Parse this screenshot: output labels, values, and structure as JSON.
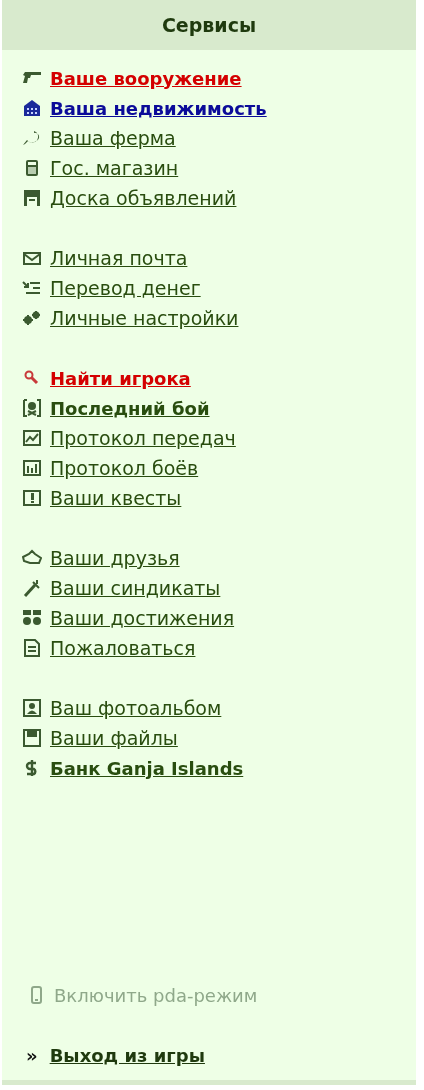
{
  "header": {
    "title": "Сервисы"
  },
  "groups": [
    {
      "items": [
        {
          "label": "Ваше вооружение",
          "kind": "alert"
        },
        {
          "label": "Ваша недвижимость",
          "kind": "new"
        },
        {
          "label": "Ваша ферма",
          "kind": "normal"
        },
        {
          "label": "Гос. магазин",
          "kind": "normal"
        },
        {
          "label": "Доска объявлений",
          "kind": "normal"
        }
      ]
    },
    {
      "items": [
        {
          "label": "Личная почта",
          "kind": "normal"
        },
        {
          "label": "Перевод денег",
          "kind": "normal"
        },
        {
          "label": "Личные настройки",
          "kind": "normal"
        }
      ]
    },
    {
      "items": [
        {
          "label": "Найти игрока",
          "kind": "alert"
        },
        {
          "label": "Последний бой",
          "kind": "bold"
        },
        {
          "label": "Протокол передач",
          "kind": "normal"
        },
        {
          "label": "Протокол боёв",
          "kind": "normal"
        },
        {
          "label": "Ваши квесты",
          "kind": "normal"
        }
      ]
    },
    {
      "items": [
        {
          "label": "Ваши друзья",
          "kind": "normal"
        },
        {
          "label": "Ваши синдикаты",
          "kind": "normal"
        },
        {
          "label": "Ваши достижения",
          "kind": "normal"
        },
        {
          "label": "Пожаловаться",
          "kind": "normal"
        }
      ]
    },
    {
      "items": [
        {
          "label": "Ваш фотоальбом",
          "kind": "normal"
        },
        {
          "label": "Ваши файлы",
          "kind": "normal"
        },
        {
          "label": "Банк Ganja Islands",
          "kind": "bold"
        }
      ]
    }
  ],
  "pda_mode": {
    "label": "Включить pda-режим",
    "disabled": true
  },
  "exit": {
    "marker": "»",
    "label": "Выход из игры"
  }
}
